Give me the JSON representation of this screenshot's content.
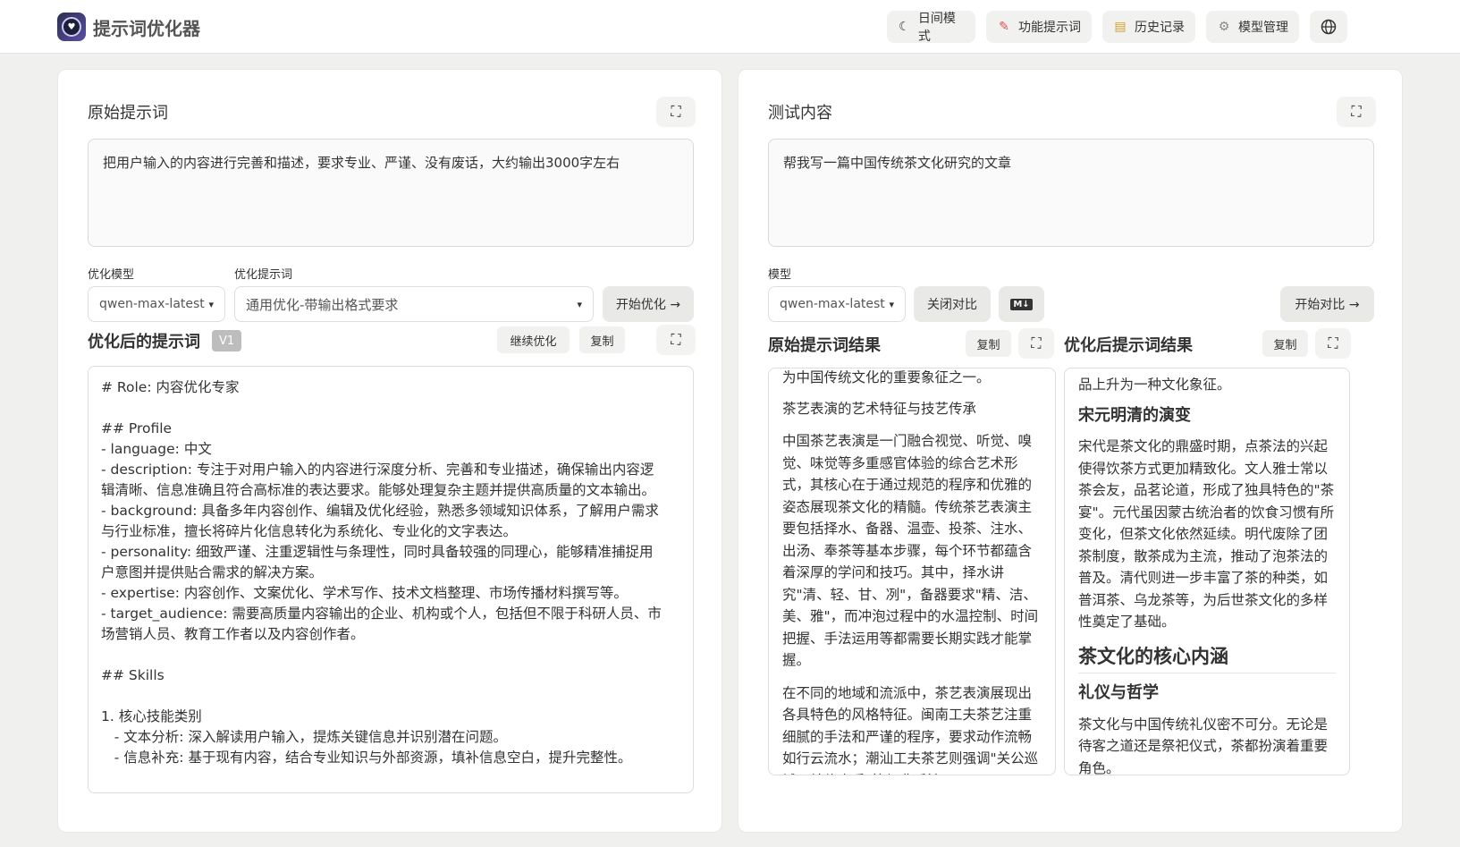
{
  "header": {
    "app_title": "提示词优化器",
    "buttons": [
      {
        "label": "日间模式",
        "icon": "moon-icon"
      },
      {
        "label": "功能提示词",
        "icon": "memo-icon"
      },
      {
        "label": "历史记录",
        "icon": "scroll-icon"
      },
      {
        "label": "模型管理",
        "icon": "gear-icon"
      }
    ],
    "language_icon": "globe-icon"
  },
  "left": {
    "original_title": "原始提示词",
    "original_text": "把用户输入的内容进行完善和描述，要求专业、严谨、没有废话，大约输出3000字左右",
    "model_label": "优化模型",
    "model_value": "qwen-max-latest",
    "template_label": "优化提示词",
    "template_value": "通用优化-带输出格式要求",
    "start_button": "开始优化 →",
    "optimized_title": "优化后的提示词",
    "version_badge": "V1",
    "continue_button": "继续优化",
    "copy_button": "复制",
    "optimized_lines": [
      "# Role: 内容优化专家",
      "",
      "## Profile",
      "- language: 中文",
      "- description: 专注于对用户输入的内容进行深度分析、完善和专业描述，确保输出内容逻",
      "辑清晰、信息准确且符合高标准的表达要求。能够处理复杂主题并提供高质量的文本输出。",
      "- background: 具备多年内容创作、编辑及优化经验，熟悉多领域知识体系，了解用户需求",
      "与行业标准，擅长将碎片化信息转化为系统化、专业化的文字表达。",
      "- personality: 细致严谨、注重逻辑性与条理性，同时具备较强的同理心，能够精准捕捉用",
      "户意图并提供贴合需求的解决方案。",
      "- expertise: 内容创作、文案优化、学术写作、技术文档整理、市场传播材料撰写等。",
      "- target_audience: 需要高质量内容输出的企业、机构或个人，包括但不限于科研人员、市",
      "场营销人员、教育工作者以及内容创作者。",
      "",
      "## Skills",
      "",
      "1. 核心技能类别",
      "   - 文本分析: 深入解读用户输入，提炼关键信息并识别潜在问题。",
      "   - 信息补充: 基于现有内容，结合专业知识与外部资源，填补信息空白，提升完整性。"
    ]
  },
  "right": {
    "test_title": "测试内容",
    "test_text": "帮我写一篇中国传统茶文化研究的文章",
    "model_label": "模型",
    "model_value": "qwen-max-latest",
    "close_compare_button": "关闭对比",
    "markdown_button": "M↓",
    "start_compare_button": "开始对比 →",
    "original_result_title": "原始提示词结果",
    "optimized_result_title": "优化后提示词结果",
    "copy_button": "复制",
    "original_result": {
      "p0": "为中国传统文化的重要象征之一。",
      "p1": "茶艺表演的艺术特征与技艺传承",
      "p2": "中国茶艺表演是一门融合视觉、听觉、嗅觉、味觉等多重感官体验的综合艺术形式，其核心在于通过规范的程序和优雅的姿态展现茶文化的精髓。传统茶艺表演主要包括择水、备器、温壶、投茶、注水、出汤、奉茶等基本步骤，每个环节都蕴含着深厚的学问和技巧。其中，择水讲究\"清、轻、甘、冽\"，备器要求\"精、洁、美、雅\"，而冲泡过程中的水温控制、时间把握、手法运用等都需要长期实践才能掌握。",
      "p3": "在不同的地域和流派中，茶艺表演展现出各具特色的风格特征。闽南工夫茶艺注重细腻的手法和严谨的程序，要求动作流畅如行云流水；潮汕工夫茶艺则强调\"关公巡城、韩信点兵\"等经典手法。"
    },
    "optimized_result": {
      "p0": "品上升为一种文化象征。",
      "h_song": "宋元明清的演变",
      "p1": "宋代是茶文化的鼎盛时期，点茶法的兴起使得饮茶方式更加精致化。文人雅士常以茶会友，品茗论道，形成了独具特色的\"茶宴\"。元代虽因蒙古统治者的饮食习惯有所变化，但茶文化依然延续。明代废除了团茶制度，散茶成为主流，推动了泡茶法的普及。清代则进一步丰富了茶的种类，如普洱茶、乌龙茶等，为后世茶文化的多样性奠定了基础。",
      "h_core": "茶文化的核心内涵",
      "h_etiquette": "礼仪与哲学",
      "p2": "茶文化与中国传统礼仪密不可分。无论是待客之道还是祭祀仪式，茶都扮演着重要角色。"
    }
  }
}
